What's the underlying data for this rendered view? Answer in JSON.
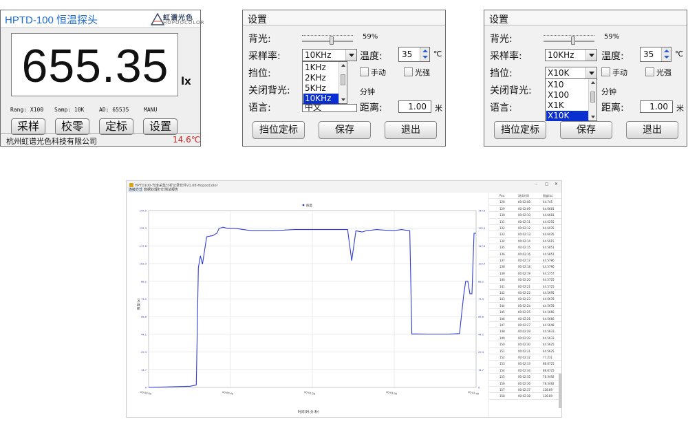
{
  "panel_main": {
    "title": "HPTD-100 恒温探头",
    "logo_cn": "虹谱光色",
    "logo_en": "HOPOOCOLOR",
    "value": "655.35",
    "unit": "lx",
    "rang": "Rang: X100",
    "samp": "Samp: 10K",
    "ad": "AD:  65535",
    "mode": "MANU",
    "buttons": [
      "采样",
      "校零",
      "定标",
      "设置"
    ],
    "company": "杭州虹谱光色科技有限公司",
    "temperature": "14.6℃"
  },
  "settings_a": {
    "title": "设置",
    "backlight_label": "背光:",
    "backlight_pct": "59%",
    "backlight_value": 0.59,
    "rate_label": "采样率:",
    "rate_value": "10KHz",
    "rate_options": [
      "1KHz",
      "2KHz",
      "5KHz",
      "10KHz"
    ],
    "rate_selected_index": 3,
    "temp_label": "温度:",
    "temp_value": "35",
    "temp_unit": "℃",
    "range_label": "挡位:",
    "manual_label": "手动",
    "highlight_label": "光强",
    "off_label": "关闭背光:",
    "minutes_label": "分钟",
    "lang_label": "语言:",
    "lang_value": "中文",
    "distance_label": "距离:",
    "distance_value": "1.00",
    "distance_unit": "米",
    "btn_calib": "挡位定标",
    "btn_save": "保存",
    "btn_exit": "退出"
  },
  "settings_b": {
    "title": "设置",
    "backlight_label": "背光:",
    "backlight_pct": "59%",
    "backlight_value": 0.59,
    "rate_label": "采样率:",
    "rate_value": "10KHz",
    "temp_label": "温度:",
    "temp_value": "35",
    "temp_unit": "℃",
    "range_label": "挡位:",
    "range_value": "X10K",
    "range_options": [
      "X10",
      "X100",
      "X1K",
      "X10K"
    ],
    "range_selected_index": 3,
    "manual_label": "手动",
    "highlight_label": "光强",
    "off_label": "关闭背光:",
    "minutes_label": "分钟",
    "lang_label": "语言:",
    "distance_label": "距离:",
    "distance_value": "1.00",
    "distance_unit": "米",
    "btn_calib": "挡位定标",
    "btn_save": "保存",
    "btn_exit": "退出"
  },
  "software": {
    "title": "HPTD100-光度采集分析记录软件V1.08-HopooColor",
    "menu": [
      "连接方式",
      "数据处理",
      "打印测试报告"
    ],
    "window_controls": [
      "–",
      "◻",
      "✕"
    ],
    "table": {
      "headers": [
        "Pos.",
        "测试时间",
        "照度(lx)"
      ],
      "rows": [
        [
          "128",
          "00:02:08",
          "44.745"
        ],
        [
          "129",
          "00:02:09",
          "44.6681"
        ],
        [
          "130",
          "00:02:10",
          "44.6681"
        ],
        [
          "131",
          "00:02:11",
          "44.6255"
        ],
        [
          "132",
          "00:02:12",
          "44.6035"
        ],
        [
          "133",
          "00:02:13",
          "44.6035"
        ],
        [
          "134",
          "00:02:14",
          "44.5915"
        ],
        [
          "135",
          "00:02:15",
          "44.5851"
        ],
        [
          "136",
          "00:02:16",
          "44.5851"
        ],
        [
          "137",
          "00:02:17",
          "44.5796"
        ],
        [
          "138",
          "00:02:18",
          "44.5796"
        ],
        [
          "139",
          "00:02:19",
          "44.5757"
        ],
        [
          "140",
          "00:02:20",
          "44.5725"
        ],
        [
          "141",
          "00:02:21",
          "44.5725"
        ],
        [
          "142",
          "00:02:22",
          "44.5695"
        ],
        [
          "143",
          "00:02:23",
          "44.5678"
        ],
        [
          "144",
          "00:02:24",
          "44.5678"
        ],
        [
          "145",
          "00:02:25",
          "44.5666"
        ],
        [
          "146",
          "00:02:26",
          "44.5666"
        ],
        [
          "147",
          "00:02:27",
          "44.5648"
        ],
        [
          "148",
          "00:02:28",
          "44.5633"
        ],
        [
          "149",
          "00:02:29",
          "44.5633"
        ],
        [
          "150",
          "00:02:30",
          "44.5625"
        ],
        [
          "151",
          "00:02:31",
          "44.5625"
        ],
        [
          "152",
          "00:02:32",
          "77.231"
        ],
        [
          "153",
          "00:02:33",
          "88.8725"
        ],
        [
          "154",
          "00:02:34",
          "88.8725"
        ],
        [
          "155",
          "00:02:35",
          "78.3492"
        ],
        [
          "156",
          "00:02:36",
          "78.3492"
        ],
        [
          "157",
          "00:02:37",
          "128.89"
        ],
        [
          "158",
          "00:02:38",
          "128.89"
        ]
      ]
    }
  },
  "chart_data": {
    "type": "line",
    "legend": "照度",
    "legend_position": "top-center",
    "ylabel": "照度(lx)",
    "xlabel": "时间(时:分:秒)",
    "ylim": [
      0,
      147.9
    ],
    "y_ticks": [
      "0",
      "14.7",
      "29.4",
      "44.1",
      "58.8",
      "73.5",
      "88.2",
      "102.9",
      "117.6",
      "132.3",
      "147.9"
    ],
    "x_ticks": [
      "00:00:00",
      "00:00:40",
      "00:01:20",
      "00:02:00",
      "00:02:40"
    ],
    "xlim": [
      0,
      158
    ],
    "grid": true,
    "line_color": "#2f3bd8",
    "x": [
      0,
      20,
      23,
      24,
      25,
      26,
      28,
      31,
      33,
      34,
      36,
      38,
      42,
      50,
      60,
      70,
      80,
      90,
      96,
      98,
      100,
      103,
      105,
      110,
      118,
      122,
      126,
      127,
      128,
      135,
      145,
      150,
      152,
      153,
      154,
      155,
      156,
      157,
      158
    ],
    "values": [
      0,
      1,
      2,
      100,
      110,
      103,
      126,
      127,
      129,
      133,
      134,
      133,
      133,
      131,
      131,
      132,
      132,
      132,
      132,
      106,
      131,
      130,
      131,
      132,
      131,
      132,
      131,
      44.6,
      44.7,
      44.6,
      44.6,
      45,
      77,
      88.9,
      88.9,
      78.3,
      78.3,
      128.9,
      128.9
    ]
  }
}
